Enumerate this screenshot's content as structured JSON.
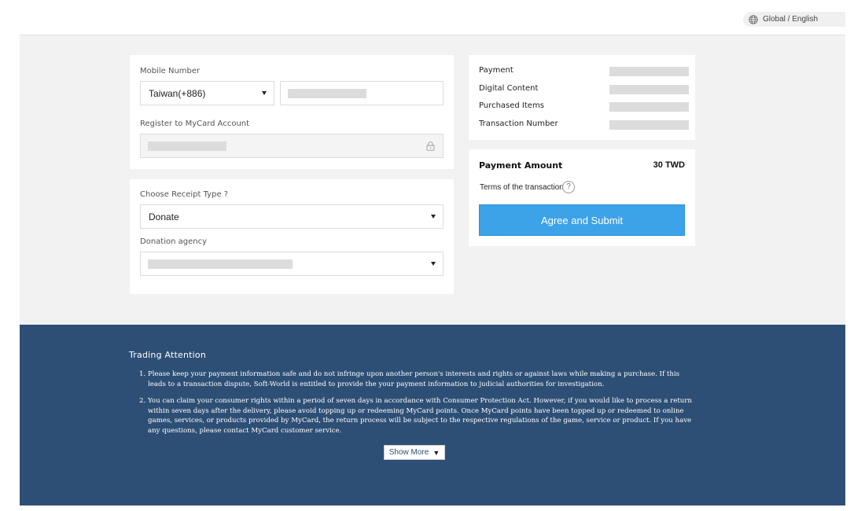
{
  "header": {
    "language_label": "Global / English",
    "language_icon": "globe-icon"
  },
  "mobile": {
    "label": "Mobile Number",
    "country_code_value": "Taiwan(+886)",
    "register_label": "Register to MyCard Account",
    "lock_icon": "lock-icon"
  },
  "receipt": {
    "label": "Choose Receipt Type ?",
    "type_value": "Donate",
    "agency_label": "Donation agency"
  },
  "order_info": {
    "rows": [
      "Payment",
      "Digital Content",
      "Purchased Items",
      "Transaction Number"
    ]
  },
  "amount": {
    "label": "Payment Amount",
    "value": "30 TWD",
    "terms_label": "Terms of the transaction",
    "help_symbol": "?",
    "submit_label": "Agree and Submit"
  },
  "footer": {
    "title": "Trading Attention",
    "items": [
      {
        "num": "1.",
        "text": "Please keep your payment information safe and do not infringe upon another person's interests and rights or against laws while making a purchase. If this leads to a transaction dispute, Soft-World is entitled to provide the your payment information to judicial authorities for investigation."
      },
      {
        "num": "2.",
        "text": "You can claim your consumer rights within a period of seven days in accordance with Consumer Protection Act. However, if you would like to process a return within seven days after the delivery, please avoid topping up or redeeming MyCard points. Once MyCard points have been topped up or redeemed to online games, services, or products provided by MyCard, the return process will be subject to the respective regulations of the game, service or product. If you have any questions, please contact MyCard customer service."
      }
    ],
    "show_more_label": "Show More",
    "show_more_symbol": "▼"
  },
  "colors": {
    "accent": "#3da3e8",
    "footer_bg": "#2e4f75",
    "page_bg": "#f2f2f2"
  }
}
